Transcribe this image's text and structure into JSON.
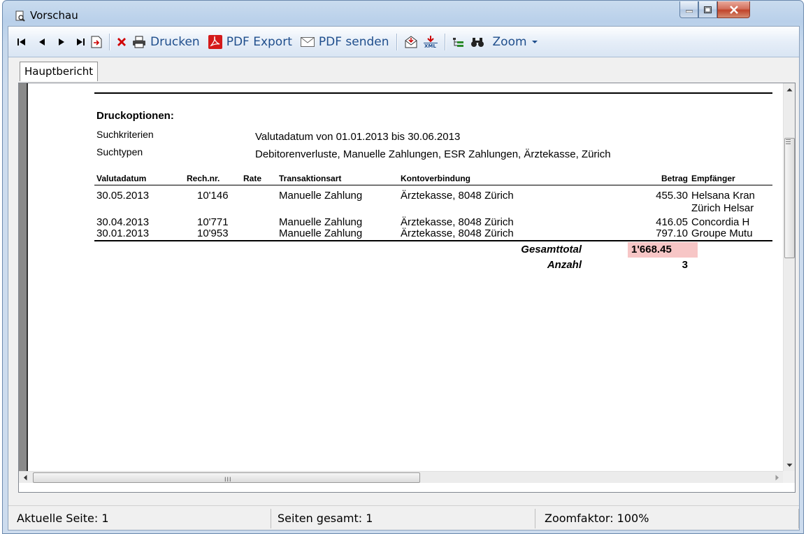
{
  "window": {
    "title": "Vorschau"
  },
  "toolbar": {
    "print_label": "Drucken",
    "pdf_export_label": "PDF Export",
    "pdf_send_label": "PDF senden",
    "zoom_label": "Zoom"
  },
  "tabs": [
    {
      "label": "Hauptbericht"
    }
  ],
  "report": {
    "section_title": "Druckoptionen:",
    "criteria_label": "Suchkriterien",
    "criteria_value": "Valutadatum von 01.01.2013 bis 30.06.2013",
    "types_label": "Suchtypen",
    "types_value": "Debitorenverluste, Manuelle Zahlungen, ESR Zahlungen, Ärztekasse, Zürich",
    "columns": {
      "date": "Valutadatum",
      "invoice": "Rech.nr.",
      "rate": "Rate",
      "type": "Transaktionsart",
      "account": "Kontoverbindung",
      "amount": "Betrag",
      "recipient": "Empfänger"
    },
    "rows": [
      {
        "date": "30.05.2013",
        "invoice": "10'146",
        "rate": "",
        "type": "Manuelle Zahlung",
        "account": "Ärztekasse, 8048 Zürich",
        "amount": "455.30",
        "recipient": "Helsana Kran",
        "recipient2": "Zürich Helsar"
      },
      {
        "date": "30.04.2013",
        "invoice": "10'771",
        "rate": "",
        "type": "Manuelle Zahlung",
        "account": "Ärztekasse, 8048 Zürich",
        "amount": "416.05",
        "recipient": "Concordia H",
        "recipient2": ""
      },
      {
        "date": "30.01.2013",
        "invoice": "10'953",
        "rate": "",
        "type": "Manuelle Zahlung",
        "account": "Ärztekasse, 8048 Zürich",
        "amount": "797.10",
        "recipient": "Groupe Mutu",
        "recipient2": ""
      }
    ],
    "total_label": "Gesamttotal",
    "total_value": "1'668.45",
    "count_label": "Anzahl",
    "count_value": "3"
  },
  "hscroll": {
    "grip": "III"
  },
  "status": {
    "current_page": "Aktuelle Seite: 1",
    "total_pages": "Seiten gesamt: 1",
    "zoom": "Zoomfaktor: 100%"
  },
  "colors": {
    "total_highlight": "#f7c6c6",
    "toolbar_text": "#1f4e8c"
  }
}
